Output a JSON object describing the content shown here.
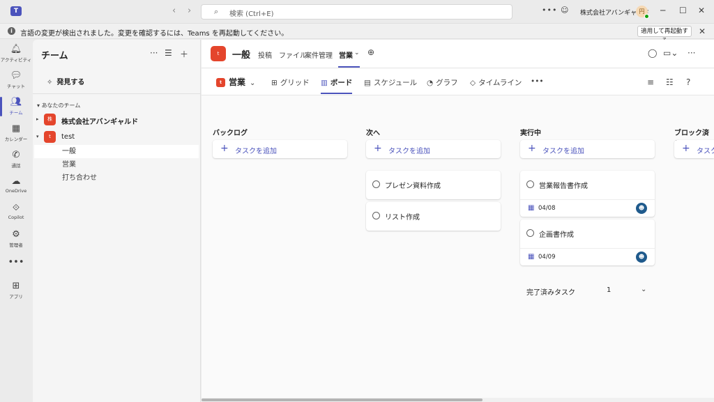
{
  "titlebar": {
    "app_logo": "T",
    "back_icon": "‹",
    "forward_icon": "›",
    "search_placeholder": "検索 (Ctrl+E)",
    "more_label": "•••",
    "org_name": "株式会社アバンギャルド",
    "avatar_text": "円"
  },
  "notification": {
    "message": "言語の変更が検出されました。変更を確認するには、Teams を再起動してください。",
    "button_label": "適用して再起動する"
  },
  "rail": {
    "items": [
      {
        "label": "アクティビティ",
        "icon": "bell-icon"
      },
      {
        "label": "チャット",
        "icon": "chat-icon"
      },
      {
        "label": "チーム",
        "icon": "teams-icon"
      },
      {
        "label": "カレンダー",
        "icon": "calendar-icon"
      },
      {
        "label": "通話",
        "icon": "phone-icon"
      },
      {
        "label": "OneDrive",
        "icon": "cloud-icon"
      },
      {
        "label": "Copilot",
        "icon": "copilot-icon"
      },
      {
        "label": "管理者",
        "icon": "admin-icon"
      },
      {
        "label": "",
        "icon": "more-icon"
      },
      {
        "label": "アプリ",
        "icon": "apps-icon"
      }
    ]
  },
  "pane": {
    "title": "チーム",
    "discover": "発見する",
    "group_header": "あなたのチーム",
    "teams": [
      {
        "name": "株式会社アバンギャルド",
        "avatar": "株"
      },
      {
        "name": "test",
        "avatar": "t"
      }
    ],
    "channels": [
      "一般",
      "営業",
      "打ち合わせ"
    ]
  },
  "header": {
    "channel_name": "一般",
    "team_avatar": "t",
    "tabs": [
      "投稿",
      "ファイル",
      "案件管理",
      "営業"
    ]
  },
  "planner": {
    "plan_name": "営業",
    "plan_avatar": "t",
    "views": [
      "グリッド",
      "ボード",
      "スケジュール",
      "グラフ",
      "タイムライン"
    ],
    "more": "•••"
  },
  "board": {
    "add_task_label": "タスクを追加",
    "columns": [
      {
        "title": "バックログ"
      },
      {
        "title": "次へ"
      },
      {
        "title": "実行中"
      },
      {
        "title": "ブロック済み"
      }
    ],
    "cards": [
      {
        "title": "プレゼン資料作成"
      },
      {
        "title": "リスト作成"
      },
      {
        "title": "営業報告書作成",
        "date": "04/08"
      },
      {
        "title": "企画書作成",
        "date": "04/09"
      }
    ],
    "completed_label": "完了済みタスク",
    "completed_count": "1"
  }
}
